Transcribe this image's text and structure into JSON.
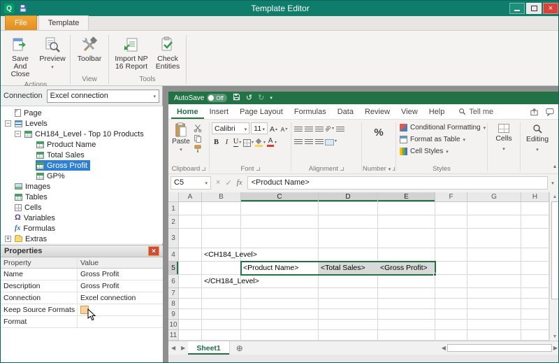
{
  "window": {
    "title": "Template Editor",
    "app_button": "Q"
  },
  "npr_tabs": {
    "file": "File",
    "template": "Template"
  },
  "npr_ribbon": {
    "actions_label": "Actions",
    "save_and_close": "Save And Close",
    "preview": "Preview",
    "view_label": "View",
    "toolbar": "Toolbar",
    "tools_label": "Tools",
    "import_np": "Import NP 16 Report",
    "check_entities": "Check Entities"
  },
  "connection": {
    "label": "Connection",
    "value": "Excel connection"
  },
  "tree": {
    "items": [
      {
        "label": "Page",
        "level": 1,
        "icon": "page"
      },
      {
        "label": "Levels",
        "level": 1,
        "icon": "levels",
        "expanded": true
      },
      {
        "label": "CH184_Level - Top 10 Products",
        "level": 2,
        "icon": "table",
        "expanded": true
      },
      {
        "label": "Product Name",
        "level": 3,
        "icon": "table"
      },
      {
        "label": "Total Sales",
        "level": 3,
        "icon": "table"
      },
      {
        "label": "Gross Profit",
        "level": 3,
        "icon": "table",
        "selected": true
      },
      {
        "label": "GP%",
        "level": 3,
        "icon": "table"
      },
      {
        "label": "Images",
        "level": 1,
        "icon": "image"
      },
      {
        "label": "Tables",
        "level": 1,
        "icon": "table"
      },
      {
        "label": "Cells",
        "level": 1,
        "icon": "cells"
      },
      {
        "label": "Variables",
        "level": 1,
        "icon": "omega"
      },
      {
        "label": "Formulas",
        "level": 1,
        "icon": "fx"
      },
      {
        "label": "Extras",
        "level": 1,
        "icon": "folder",
        "expanded": false
      }
    ]
  },
  "properties": {
    "title": "Properties",
    "columns": [
      "Property",
      "Value"
    ],
    "rows": [
      {
        "property": "Name",
        "value": "Gross Profit"
      },
      {
        "property": "Description",
        "value": "Gross Profit"
      },
      {
        "property": "Connection",
        "value": "Excel connection"
      },
      {
        "property": "Keep Source Formats",
        "value": "",
        "checkbox": true
      },
      {
        "property": "Format",
        "value": ""
      }
    ]
  },
  "excel": {
    "autosave_label": "AutoSave",
    "autosave_state": "Off",
    "tabs": [
      "Home",
      "Insert",
      "Page Layout",
      "Formulas",
      "Data",
      "Review",
      "View",
      "Help"
    ],
    "active_tab": "Home",
    "tell_me": "Tell me",
    "ribbon": {
      "clipboard_label": "Clipboard",
      "paste": "Paste",
      "font_label": "Font",
      "font_name": "Calibri",
      "font_size": "11",
      "alignment_label": "Alignment",
      "number_label": "Number",
      "styles_label": "Styles",
      "conditional_formatting": "Conditional Formatting",
      "format_as_table": "Format as Table",
      "cell_styles": "Cell Styles",
      "cells_label": "Cells",
      "editing_label": "Editing"
    },
    "formula_bar": {
      "name_box": "C5",
      "formula": "<Product Name>"
    },
    "grid": {
      "columns": [
        "A",
        "B",
        "C",
        "D",
        "E",
        "F",
        "G",
        "H"
      ],
      "rows": [
        "1",
        "2",
        "3",
        "4",
        "5",
        "6",
        "7",
        "8",
        "9",
        "10",
        "11"
      ],
      "selected_columns": [
        "C",
        "D",
        "E"
      ],
      "selected_row": "5",
      "selection_range": "C5:E5",
      "cells": [
        {
          "ref": "B4",
          "text": "<CH184_Level>"
        },
        {
          "ref": "C5",
          "text": "<Product Name>",
          "active": true
        },
        {
          "ref": "D5",
          "text": "<Total Sales>",
          "shaded": true
        },
        {
          "ref": "E5",
          "text": "<Gross Profit>",
          "shaded": true
        },
        {
          "ref": "B6",
          "text": "</CH184_Level>"
        }
      ]
    },
    "sheet_tab": "Sheet1"
  },
  "icons": {
    "minus": "−",
    "plus": "+",
    "close": "×",
    "cancel": "×",
    "check": "✓",
    "omega": "Ω",
    "fx": "fx",
    "percent": "%",
    "undo": "↺",
    "redo": "↻",
    "add_sheet": "⊕",
    "caret_up": "▴",
    "caret_down": "▾",
    "arrow_left": "◀",
    "arrow_right": "▶",
    "arrow_up": "▲",
    "arrow_down": "▼",
    "bold": "B",
    "italic": "I",
    "underline": "U",
    "a_letter": "A",
    "ab": "ab"
  }
}
